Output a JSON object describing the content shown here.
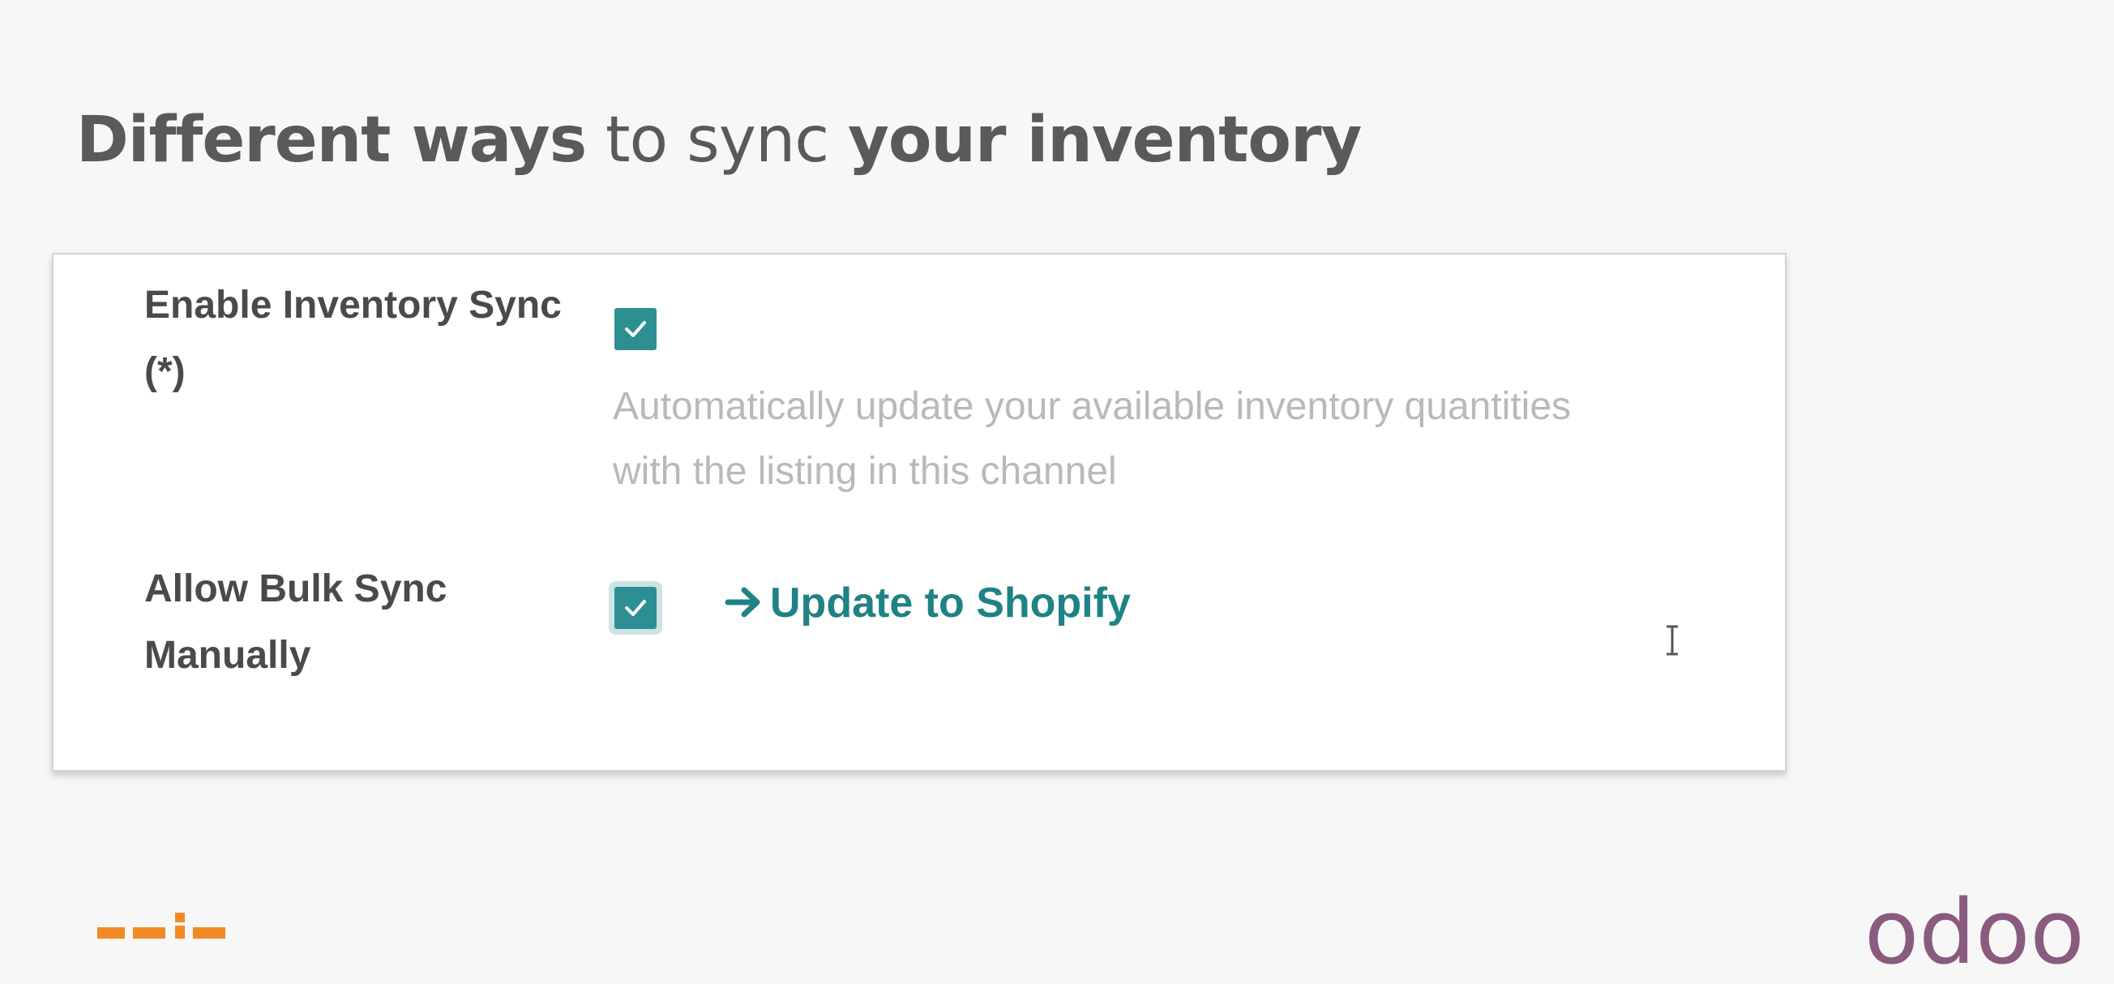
{
  "slide": {
    "title_parts": {
      "part1": "Different ways",
      "part2": "to sync",
      "part3": "your inventory"
    }
  },
  "settings": {
    "inventory_sync": {
      "label_line1": "Enable Inventory Sync",
      "label_line2": "(*)",
      "checked": true,
      "description_line1": "Automatically update your available inventory quantities",
      "description_line2": "with the listing in this channel"
    },
    "bulk_sync": {
      "label_line1": "Allow Bulk Sync",
      "label_line2": "Manually",
      "checked": true,
      "action_label": "Update to Shopify",
      "action_icon": "arrow-right-icon"
    }
  },
  "branding": {
    "right_logo_text": "odoo",
    "accent_color": "#2e8f92",
    "link_color": "#1f8285",
    "left_logo_color": "#f08a24",
    "right_logo_color": "#8a5a7f"
  }
}
